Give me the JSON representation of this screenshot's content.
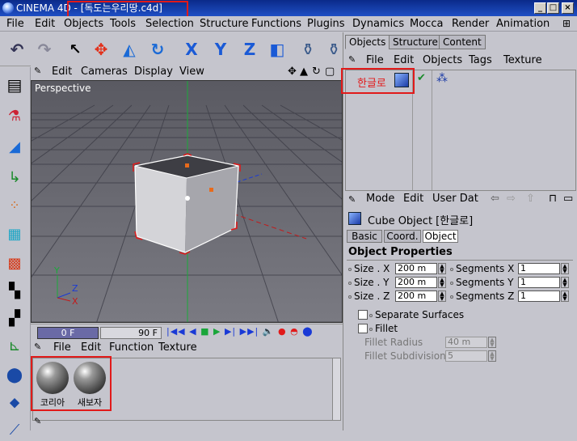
{
  "window": {
    "app": "CINEMA 4D",
    "title_sep": " - ",
    "file": "[독도는우리땅.c4d]"
  },
  "menubar": [
    "File",
    "Edit",
    "Objects",
    "Tools",
    "Selection",
    "Structure",
    "Functions",
    "Plugins",
    "Dynamics",
    "Mocca",
    "Render",
    "Animation"
  ],
  "viewport": {
    "menu": [
      "Edit",
      "Cameras",
      "Display",
      "View"
    ],
    "label": "Perspective"
  },
  "timeline": {
    "start": "0 F",
    "end": "90 F"
  },
  "material_manager": {
    "menu": [
      "File",
      "Edit",
      "Function",
      "Texture"
    ],
    "materials": [
      {
        "name": "코리아"
      },
      {
        "name": "새보자"
      }
    ]
  },
  "object_manager": {
    "tabs": [
      "Objects",
      "Structure",
      "Content"
    ],
    "menu": [
      "File",
      "Edit",
      "Objects",
      "Tags",
      "Texture"
    ],
    "object_name": "한글로"
  },
  "attributes": {
    "menu": [
      "Mode",
      "Edit",
      "User Dat"
    ],
    "object_title": "Cube Object [한글로]",
    "tabs": [
      "Basic",
      "Coord.",
      "Object"
    ],
    "section": "Object Properties",
    "size": [
      {
        "label": "Size . X",
        "value": "200 m"
      },
      {
        "label": "Size . Y",
        "value": "200 m"
      },
      {
        "label": "Size . Z",
        "value": "200 m"
      }
    ],
    "segments": [
      {
        "label": "Segments X",
        "value": "1"
      },
      {
        "label": "Segments Y",
        "value": "1"
      },
      {
        "label": "Segments Z",
        "value": "1"
      }
    ],
    "separate_surfaces": "Separate Surfaces",
    "fillet": "Fillet",
    "fillet_radius": {
      "label": "Fillet Radius",
      "value": "40 m"
    },
    "fillet_subdivision": {
      "label": "Fillet Subdivision",
      "value": "5"
    }
  },
  "colors": {
    "highlight": "#e11a1a",
    "title_bar": "#0a2a8a",
    "viewport_bg": "#707078"
  }
}
